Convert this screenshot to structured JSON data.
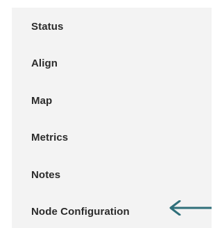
{
  "menu": {
    "items": [
      {
        "label": "Status"
      },
      {
        "label": "Align"
      },
      {
        "label": "Map"
      },
      {
        "label": "Metrics"
      },
      {
        "label": "Notes"
      },
      {
        "label": "Node Configuration"
      }
    ]
  },
  "annotation": {
    "icon": "arrow-left-icon",
    "color": "#2f6f7a"
  },
  "colors": {
    "panel_background": "#f3f3f3",
    "text": "#2b2b2b"
  }
}
